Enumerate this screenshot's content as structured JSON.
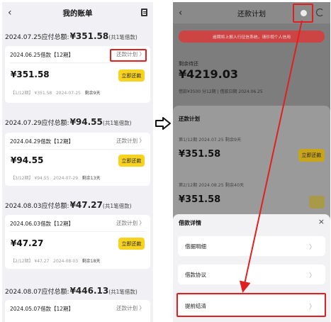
{
  "left": {
    "title": "我的账单",
    "back_icon": "chevron-left-icon",
    "bill_icon": "document-icon",
    "groups": [
      {
        "due_label": "2024.07.25应付总额:",
        "due_amount": "¥351.58",
        "due_count": "(共1笔借款)",
        "loan": "2024.06.25借款【12期】",
        "plan_link": "还款计划 〉",
        "amount": "¥351.58",
        "pay": "立即还款",
        "period": "【1/12期】",
        "meta_amount": "¥351.58",
        "date": "2024-07-25",
        "days": "剩余9天"
      },
      {
        "due_label": "2024.07.29应付总额:",
        "due_amount": "¥94.55",
        "due_count": "(共1笔借款)",
        "loan": "2024.04.29借款【12期】",
        "plan_link": "还款计划 〉",
        "amount": "¥94.55",
        "pay": "立即还款",
        "period": "【3/12期】",
        "meta_amount": "¥94.55",
        "date": "2024-07-29",
        "days": "剩余13天"
      },
      {
        "due_label": "2024.08.03应付总额:",
        "due_amount": "¥47.27",
        "due_count": "(共1笔借款)",
        "loan": "2024.06.03借款【12期】",
        "plan_link": "还款计划 〉",
        "amount": "¥47.27",
        "pay": "立即还款",
        "period": "【2/12期】",
        "meta_amount": "¥47.27",
        "date": "2024-08-03",
        "days": "剩余18天"
      },
      {
        "due_label": "2024.08.07应付总额:",
        "due_amount": "¥446.13",
        "due_count": "(共1笔借款)",
        "loan": "2024.05.07借款【12期】",
        "plan_link": "还款计划 〉"
      }
    ]
  },
  "right": {
    "title": "还款计划",
    "back_icon": "chevron-left-icon",
    "more_icon": "more-dots-icon",
    "service_icon": "headset-icon",
    "banner": "逾期将上报人行征信系统，请珍视个人信用",
    "remaining_label": "剩余待还",
    "remaining_amount": "¥4219.03",
    "remaining_sub": "借款¥3500 分12期  |  借款日期 2024.06.25",
    "schedule_title": "还款计划",
    "rows": [
      {
        "label": "第1/12期",
        "date": "2024.07.25",
        "days": "剩余9天",
        "amount": "¥351.58",
        "pay": "立即还款"
      },
      {
        "label": "第2/12期",
        "date": "2024.08.25",
        "days": "剩余40天",
        "amount": "¥351.58"
      }
    ],
    "sheet": {
      "title": "借款详情",
      "close": "×",
      "options": [
        {
          "label": "借据明细",
          "chev": "〉"
        },
        {
          "label": "借款协议",
          "chev": "〉"
        },
        {
          "label": "提前结清",
          "chev": "〉"
        }
      ]
    }
  },
  "colors": {
    "highlight": "#e02020",
    "pay_button": "#f7d21e",
    "page_bg": "#f1f1f5"
  }
}
